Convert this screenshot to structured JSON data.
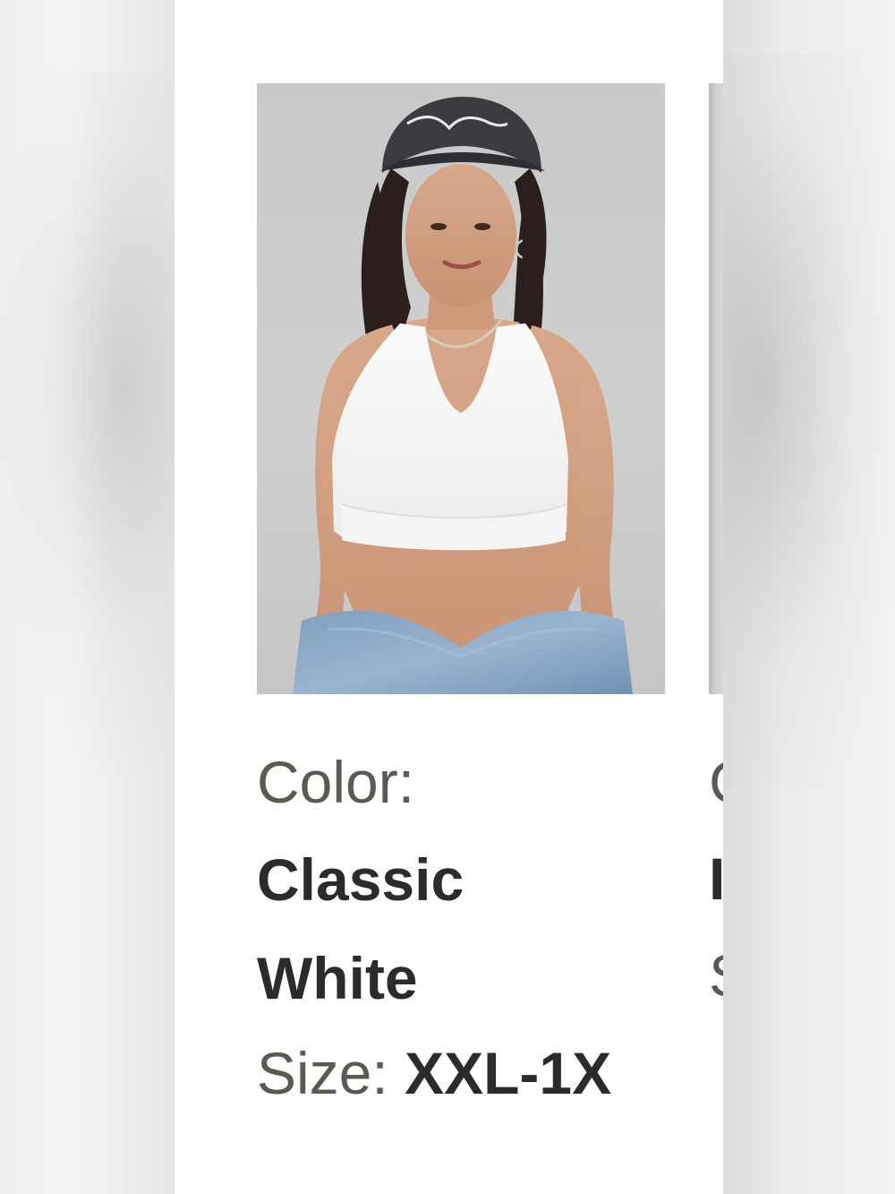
{
  "product": {
    "image_alt": "Model wearing white halter sports bra, black Fabletics cap and blue tie-dye leggings",
    "color_label": "Color:",
    "color_value": "Classic White",
    "size_label": "Size:",
    "size_value": "XXL-1X"
  },
  "next_product": {
    "color_label_fragment": "C",
    "color_value_fragment": "I",
    "size_label_fragment": "S"
  },
  "colors": {
    "page_background": "#ffffff",
    "label_text": "#5a5a52",
    "value_text": "#2b2b2b",
    "image_background": "#cccccc"
  },
  "icons": {
    "cap_logo": "script-logo"
  }
}
